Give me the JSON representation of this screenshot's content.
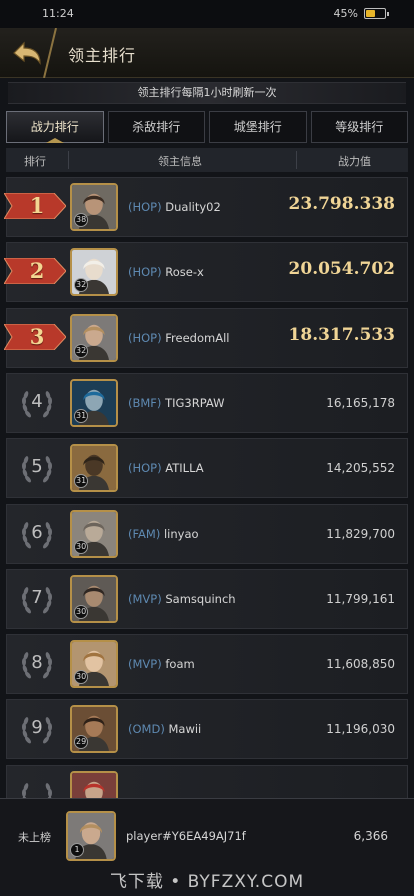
{
  "status_bar": {
    "time": "11:24",
    "battery_text": "45%",
    "battery_level": 0.45
  },
  "header": {
    "title": "领主排行",
    "back_icon": "back-arrow-icon"
  },
  "notice": "领主排行每隔1小时刷新一次",
  "tabs": [
    {
      "label": "战力排行",
      "active": true
    },
    {
      "label": "杀敌排行",
      "active": false
    },
    {
      "label": "城堡排行",
      "active": false
    },
    {
      "label": "等级排行",
      "active": false
    }
  ],
  "columns": {
    "rank": "排行",
    "info": "领主信息",
    "power": "战力值"
  },
  "rows": [
    {
      "rank": "1",
      "level": "38",
      "alliance": "(HOP)",
      "name": "Duality02",
      "power": "23.798.338",
      "avatar": {
        "bg": "#6f6a62",
        "face": "#b89478",
        "hair": "#3b2c22"
      }
    },
    {
      "rank": "2",
      "level": "32",
      "alliance": "(HOP)",
      "name": "Rose-x",
      "power": "20.054.702",
      "avatar": {
        "bg": "#cfd2d6",
        "face": "#e8dccd",
        "hair": "#f2efe8"
      }
    },
    {
      "rank": "3",
      "level": "32",
      "alliance": "(HOP)",
      "name": "FreedomAll",
      "power": "18.317.533",
      "avatar": {
        "bg": "#7d7a78",
        "face": "#caa98e",
        "hair": "#b38f60"
      }
    },
    {
      "rank": "4",
      "level": "31",
      "alliance": "(BMF)",
      "name": "TIG3RPAW",
      "power": "16,165,178",
      "avatar": {
        "bg": "#1c3d55",
        "face": "#8da6b4",
        "hair": "#1e6b9c"
      }
    },
    {
      "rank": "5",
      "level": "31",
      "alliance": "(HOP)",
      "name": "ATILLA",
      "power": "14,205,552",
      "avatar": {
        "bg": "#8a6a3f",
        "face": "#4a3826",
        "hair": "#2e2419"
      }
    },
    {
      "rank": "6",
      "level": "30",
      "alliance": "(FAM)",
      "name": "linyao",
      "power": "11,829,700",
      "avatar": {
        "bg": "#8b857d",
        "face": "#b9aa98",
        "hair": "#6c645b"
      }
    },
    {
      "rank": "7",
      "level": "30",
      "alliance": "(MVP)",
      "name": "Samsquinch",
      "power": "11,799,161",
      "avatar": {
        "bg": "#5f5a55",
        "face": "#a88a70",
        "hair": "#2f2722"
      }
    },
    {
      "rank": "8",
      "level": "30",
      "alliance": "(MVP)",
      "name": "foam",
      "power": "11,608,850",
      "avatar": {
        "bg": "#b39570",
        "face": "#e2c3a2",
        "hair": "#a0733f"
      }
    },
    {
      "rank": "9",
      "level": "29",
      "alliance": "(OMD)",
      "name": "Mawii",
      "power": "11,196,030",
      "avatar": {
        "bg": "#6b4e35",
        "face": "#a67a57",
        "hair": "#2e2118"
      }
    }
  ],
  "partial_row": {
    "avatar": {
      "bg": "#7a3f3a",
      "face": "#c7a48a",
      "hair": "#b8332b"
    }
  },
  "footer": {
    "rank_label": "未上榜",
    "level": "1",
    "name": "player#Y6EA49AJ71f",
    "power": "6,366",
    "avatar": {
      "bg": "#7d7a78",
      "face": "#caa98e",
      "hair": "#b38f60"
    }
  },
  "watermark": "飞下载 • BYFZXY.COM",
  "colors": {
    "gold": "#f0d596",
    "alliance": "#5e89b1",
    "ribbon": "#b8392a"
  }
}
